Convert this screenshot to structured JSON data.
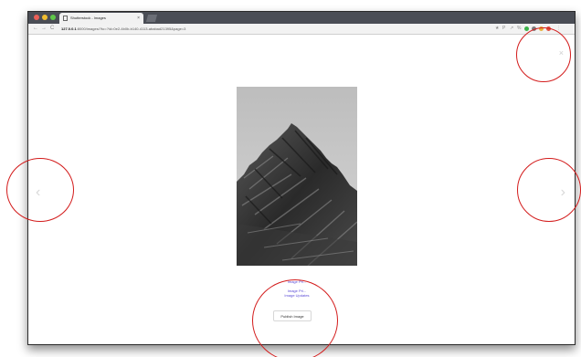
{
  "browser": {
    "tab_title": "Shutterstock - Images",
    "tab_close": "×",
    "url_host": "127.0.0.1",
    "url_path": ":8000/images/?to=?id=0e2-4b0b-b140-4113-ababad21395&page=3",
    "nav": {
      "back": "←",
      "forward": "→",
      "reload": "C"
    },
    "toolbar_icons": [
      "★",
      "P",
      "↗",
      "%"
    ]
  },
  "viewer": {
    "close_glyph": "×",
    "prev_glyph": "‹",
    "next_glyph": "›",
    "links": {
      "first": "Image Pri...",
      "second": "Image Pri...",
      "third": "Image Updates"
    },
    "publish_button": "Publish Image"
  },
  "colors": {
    "annotation": "#d31b1b",
    "link": "#5a4bd6"
  }
}
